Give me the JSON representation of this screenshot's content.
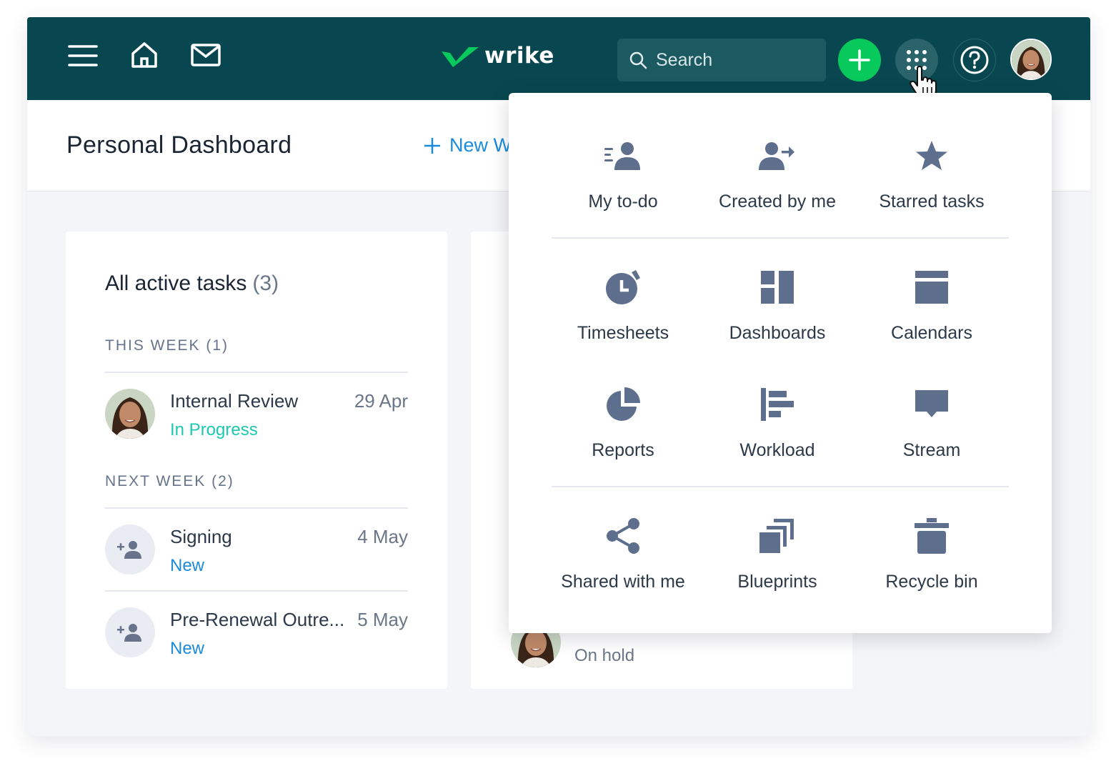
{
  "topbar": {
    "icons": [
      "menu-icon",
      "home-icon",
      "mail-icon"
    ],
    "logo_text": "wrike",
    "search_placeholder": "Search",
    "create_icon": "plus-icon",
    "apps_icon": "grid-icon",
    "help_icon": "help-icon",
    "colors": {
      "bar": "#08474f",
      "create": "#08c95b",
      "search": "#1c5a62"
    }
  },
  "header": {
    "title": "Personal Dashboard",
    "new_widget_label": "New W"
  },
  "tasks_card": {
    "title": "All active tasks",
    "count": "(3)",
    "groups": [
      {
        "label": "THIS WEEK (1)",
        "tasks": [
          {
            "name": "Internal Review",
            "date": "29 Apr",
            "status": "In Progress"
          }
        ]
      },
      {
        "label": "NEXT WEEK (2)",
        "tasks": [
          {
            "name": "Signing",
            "date": "4 May",
            "status": "New"
          },
          {
            "name": "Pre-Renewal Outre...",
            "date": "5 May",
            "status": "New"
          }
        ]
      }
    ]
  },
  "second_card": {
    "status": "On hold"
  },
  "apps_menu": {
    "sections": [
      [
        {
          "label": "My to-do",
          "icon": "todo-icon"
        },
        {
          "label": "Created by me",
          "icon": "created-by-me-icon"
        },
        {
          "label": "Starred tasks",
          "icon": "star-icon"
        }
      ],
      [
        {
          "label": "Timesheets",
          "icon": "timer-icon"
        },
        {
          "label": "Dashboards",
          "icon": "dashboard-icon"
        },
        {
          "label": "Calendars",
          "icon": "calendar-icon"
        },
        {
          "label": "Reports",
          "icon": "pie-chart-icon"
        },
        {
          "label": "Workload",
          "icon": "workload-icon"
        },
        {
          "label": "Stream",
          "icon": "stream-icon"
        }
      ],
      [
        {
          "label": "Shared with me",
          "icon": "share-icon"
        },
        {
          "label": "Blueprints",
          "icon": "blueprint-icon"
        },
        {
          "label": "Recycle bin",
          "icon": "trash-icon"
        }
      ]
    ]
  }
}
